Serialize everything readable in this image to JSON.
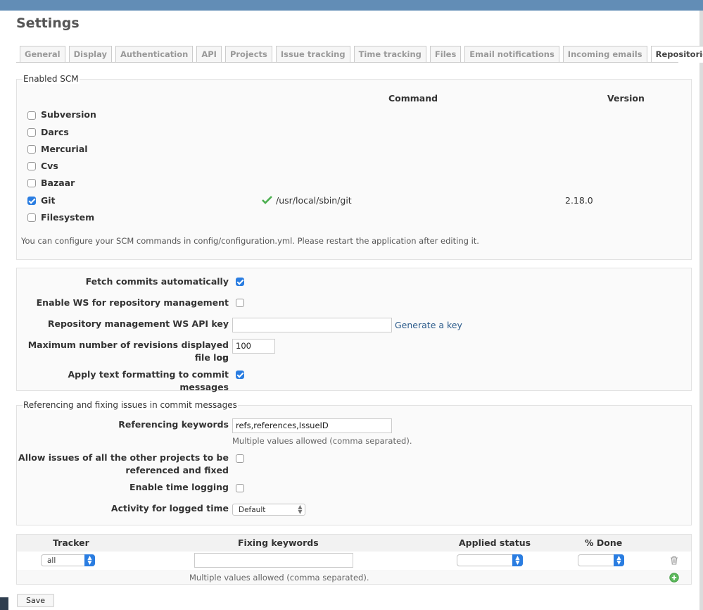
{
  "page": {
    "title": "Settings"
  },
  "tabs": [
    "General",
    "Display",
    "Authentication",
    "API",
    "Projects",
    "Issue tracking",
    "Time tracking",
    "Files",
    "Email notifications",
    "Incoming emails",
    "Repositories"
  ],
  "selected_tab": "Repositories",
  "scm": {
    "legend": "Enabled SCM",
    "col_command": "Command",
    "col_version": "Version",
    "items": [
      {
        "name": "Subversion",
        "checked": false,
        "command": "",
        "version": ""
      },
      {
        "name": "Darcs",
        "checked": false,
        "command": "",
        "version": ""
      },
      {
        "name": "Mercurial",
        "checked": false,
        "command": "",
        "version": ""
      },
      {
        "name": "Cvs",
        "checked": false,
        "command": "",
        "version": ""
      },
      {
        "name": "Bazaar",
        "checked": false,
        "command": "",
        "version": ""
      },
      {
        "name": "Git",
        "checked": true,
        "command": "/usr/local/sbin/git",
        "version": "2.18.0"
      },
      {
        "name": "Filesystem",
        "checked": false,
        "command": "",
        "version": ""
      }
    ],
    "note": "You can configure your SCM commands in config/configuration.yml. Please restart the application after editing it."
  },
  "general": {
    "fetch_label": "Fetch commits automatically",
    "fetch_checked": true,
    "ws_label": "Enable WS for repository management",
    "ws_checked": false,
    "apikey_label": "Repository management WS API key",
    "apikey_value": "",
    "generate_link": "Generate a key",
    "maxrev_label_1": "Maximum number of revisions displayed on",
    "maxrev_label_2": "file log",
    "maxrev_value": "100",
    "formatting_label": "Apply text formatting to commit messages",
    "formatting_checked": true
  },
  "referencing": {
    "legend": "Referencing and fixing issues in commit messages",
    "keywords_label": "Referencing keywords",
    "keywords_value": "refs,references,IssueID",
    "keywords_hint": "Multiple values allowed (comma separated).",
    "crossproj_label_1": "Allow issues of all the other projects to be",
    "crossproj_label_2": "referenced and fixed",
    "crossproj_checked": false,
    "timelog_label": "Enable time logging",
    "timelog_checked": false,
    "activity_label": "Activity for logged time",
    "activity_value": "Default"
  },
  "fixing": {
    "headers": {
      "tracker": "Tracker",
      "keywords": "Fixing keywords",
      "status": "Applied status",
      "done": "% Done"
    },
    "row": {
      "tracker": "all",
      "keywords": "",
      "status": "",
      "done": ""
    },
    "hint": "Multiple values allowed (comma separated)."
  },
  "save_label": "Save",
  "colors": {
    "accent": "#2a7de1",
    "topbar": "#628db6",
    "link": "#2a5a8a",
    "check": "#4caf50"
  }
}
